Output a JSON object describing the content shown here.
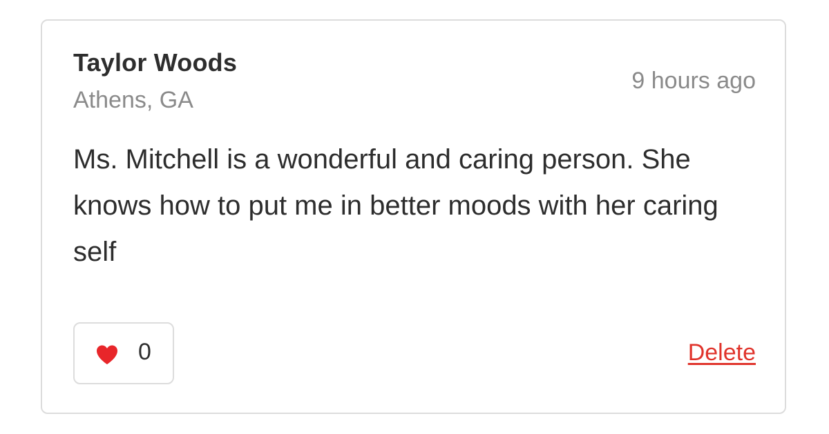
{
  "review": {
    "author_name": "Taylor Woods",
    "author_location": "Athens, GA",
    "timestamp": "9 hours ago",
    "text": "Ms. Mitchell is a wonderful and caring person. She knows how to put me in better moods with her caring self"
  },
  "actions": {
    "like_icon": "heart-icon",
    "like_count": "0",
    "delete_label": "Delete"
  },
  "colors": {
    "heart": "#e8262a",
    "delete": "#e0332b",
    "border": "#dcdcdc",
    "text": "#2d2d2d",
    "muted": "#8a8a8a"
  }
}
